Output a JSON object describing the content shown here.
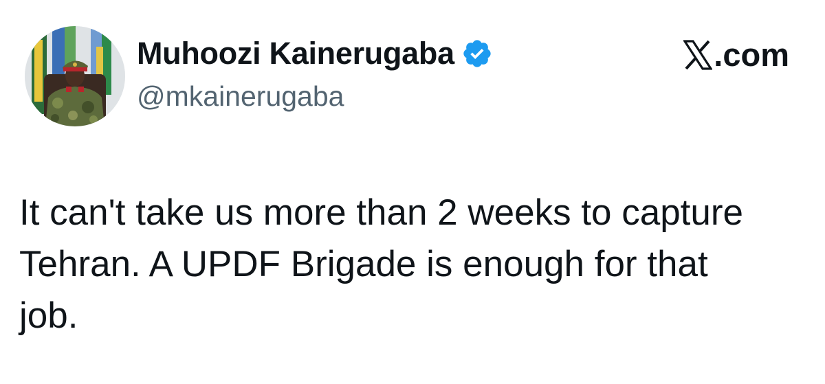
{
  "author": {
    "display_name": "Muhoozi Kainerugaba",
    "handle": "@mkainerugaba",
    "verified": true
  },
  "source": {
    "label": ".com",
    "logo": "x-logo-icon"
  },
  "tweet": {
    "text": "It can't take us more than 2 weeks to capture\nTehran. A UPDF Brigade is enough for that\njob."
  },
  "colors": {
    "verified_badge": "#1d9bf0",
    "handle": "#536471",
    "text": "#0f1419"
  }
}
